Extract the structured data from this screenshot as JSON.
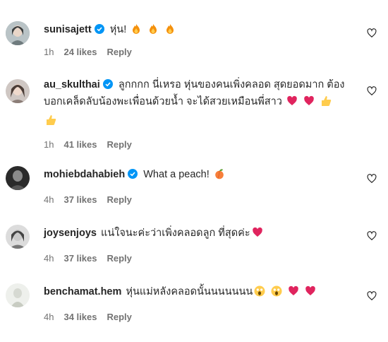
{
  "comments": [
    {
      "username": "sunisajett",
      "verified": true,
      "text": "หุ่น!",
      "emojis": [
        "fire",
        "fire",
        "fire"
      ],
      "time": "1h",
      "likes": "24 likes",
      "reply": "Reply"
    },
    {
      "username": "au_skulthai",
      "verified": true,
      "text": "ลูกกกก นี่เหรอ หุ่นของคนเพิ่งคลอด สุดยอดมาก ต้อง",
      "text2": "บอกเคล็ดลับน้องพะเพื่อนด้วยน้ำ จะได้สวยเหมือนพี่สาว",
      "emojis": [
        "heart",
        "heart",
        "thumbs-up"
      ],
      "emojis2": [
        "thumbs-up"
      ],
      "time": "1h",
      "likes": "41 likes",
      "reply": "Reply"
    },
    {
      "username": "mohiebdahabieh",
      "verified": true,
      "text": "What a peach!",
      "emojis": [
        "peach"
      ],
      "time": "4h",
      "likes": "37 likes",
      "reply": "Reply"
    },
    {
      "username": "joysenjoys",
      "verified": false,
      "text": "แน่ใจนะค่ะว่าเพิ่งคลอดลูก ที่สุดค่ะ",
      "emojis": [
        "heart"
      ],
      "time": "4h",
      "likes": "37 likes",
      "reply": "Reply"
    },
    {
      "username": "benchamat.hem",
      "verified": false,
      "text": "หุ่นแม่หลังคลอดนั้นนนนนนน",
      "emojis": [
        "scream",
        "scream",
        "heart",
        "heart"
      ],
      "time": "4h",
      "likes": "34 likes",
      "reply": "Reply"
    }
  ],
  "colors": {
    "verified": "#0095f6",
    "heart": "#e0245e",
    "muted": "#737373"
  }
}
